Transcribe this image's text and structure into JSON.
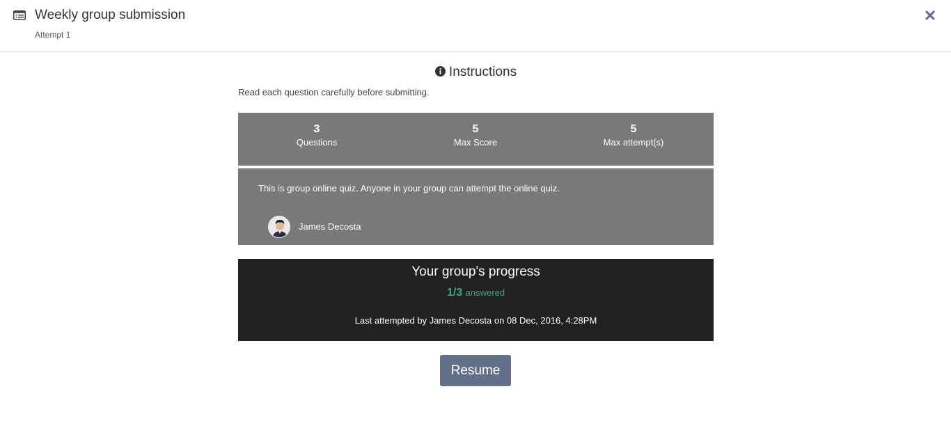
{
  "header": {
    "icon": "list-icon",
    "title": "Weekly group submission",
    "subtitle": "Attempt 1",
    "close_icon": "close-icon"
  },
  "instructions": {
    "icon": "info-icon",
    "title": "Instructions",
    "text": "Read each question carefully before submitting."
  },
  "stats": [
    {
      "value": "3",
      "label": "Questions"
    },
    {
      "value": "5",
      "label": "Max Score"
    },
    {
      "value": "5",
      "label": "Max attempt(s)"
    }
  ],
  "group": {
    "text": "This is group online quiz. Anyone in your group can attempt the online quiz.",
    "members": [
      {
        "name": "James Decosta",
        "avatar": "avatar"
      }
    ]
  },
  "progress": {
    "title": "Your group's progress",
    "count": "1/3",
    "count_word": "answered",
    "last_attempted": "Last attempted by James Decosta on 08 Dec, 2016, 4:28PM"
  },
  "resume_button": "Resume",
  "colors": {
    "stats_bg": "#797979",
    "progress_bg": "#212121",
    "progress_accent": "#3fa77a",
    "button_bg": "#627089"
  }
}
